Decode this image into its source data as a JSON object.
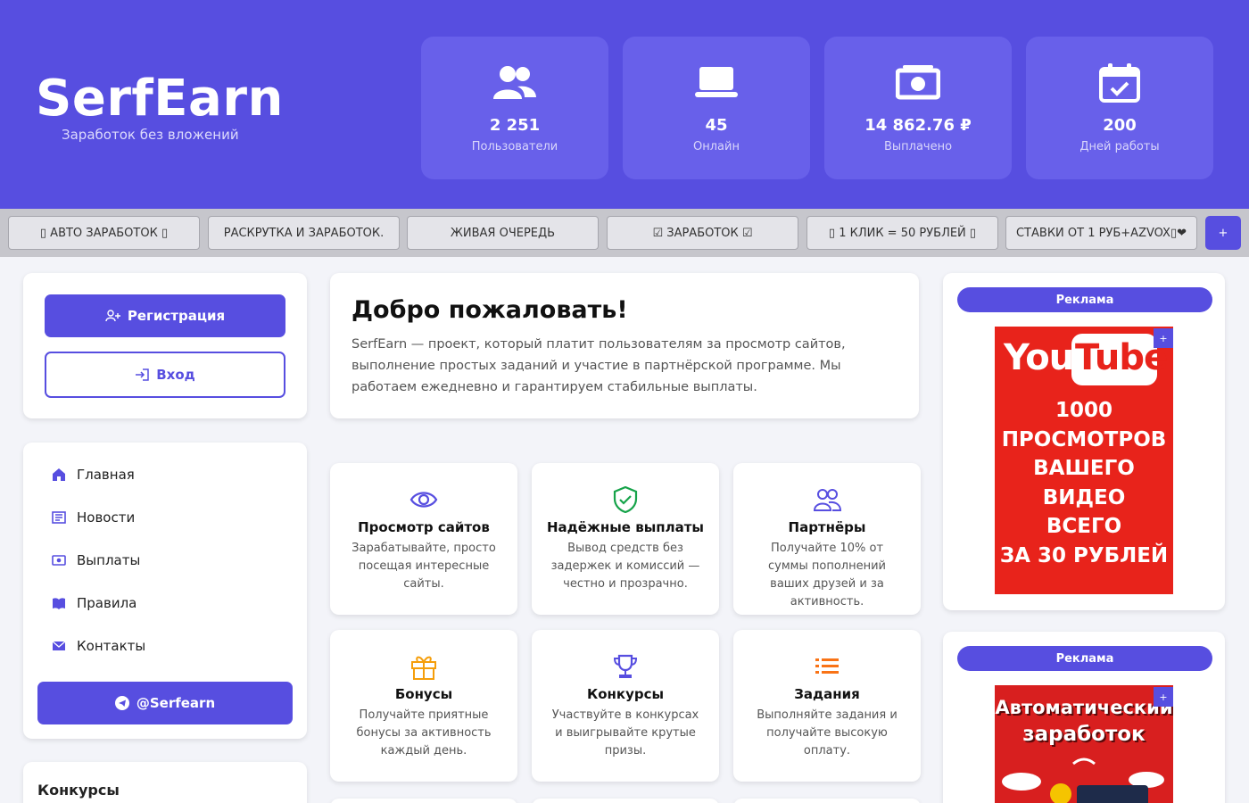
{
  "brand": {
    "name": "SerfEarn",
    "tagline": "Заработок без вложений"
  },
  "stats": [
    {
      "value": "2 251",
      "label": "Пользователи",
      "icon": "users-icon"
    },
    {
      "value": "45",
      "label": "Онлайн",
      "icon": "laptop-icon"
    },
    {
      "value": "14 862.76 ₽",
      "label": "Выплачено",
      "icon": "money-bill-icon"
    },
    {
      "value": "200",
      "label": "Дней работы",
      "icon": "calendar-check-icon"
    }
  ],
  "ticker": {
    "items": [
      "▯ АВТО ЗАРАБОТОК ▯",
      "РАСКРУТКА И ЗАРАБОТОК.",
      "ЖИВАЯ ОЧЕРЕДЬ",
      "☑ ЗАРАБОТОК ☑",
      "▯ 1 КЛИК = 50 РУБЛЕЙ ▯",
      "СТАВКИ ОТ 1 РУБ+AZVOX▯❤"
    ],
    "plus": "+"
  },
  "auth": {
    "register": "Регистрация",
    "login": "Вход"
  },
  "menu": {
    "items": [
      {
        "label": "Главная",
        "icon": "home-icon"
      },
      {
        "label": "Новости",
        "icon": "newspaper-icon"
      },
      {
        "label": "Выплаты",
        "icon": "money-icon"
      },
      {
        "label": "Правила",
        "icon": "book-icon"
      },
      {
        "label": "Контакты",
        "icon": "envelope-icon"
      }
    ],
    "telegram": "@Serfearn"
  },
  "contests": {
    "title": "Конкурсы"
  },
  "welcome": {
    "title": "Добро пожаловать!",
    "text": "SerfEarn — проект, который платит пользователям за просмотр сайтов, выполнение простых заданий и участие в партнёрской программе. Мы работаем ежедневно и гарантируем стабильные выплаты."
  },
  "features": [
    {
      "title": "Просмотр сайтов",
      "desc": "Зарабатывайте, просто посещая интересные сайты.",
      "icon": "eye-icon"
    },
    {
      "title": "Надёжные выплаты",
      "desc": "Вывод средств без задержек и комиссий — честно и прозрачно.",
      "icon": "shield-check-icon"
    },
    {
      "title": "Партнёры",
      "desc": "Получайте 10% от суммы пополнений ваших друзей и за активность.",
      "icon": "partners-icon"
    },
    {
      "title": "Бонусы",
      "desc": "Получайте приятные бонусы за активность каждый день.",
      "icon": "gift-icon"
    },
    {
      "title": "Конкурсы",
      "desc": "Участвуйте в конкурсах и выигрывайте крутые призы.",
      "icon": "trophy-icon"
    },
    {
      "title": "Задания",
      "desc": "Выполняйте задания и получайте высокую оплату.",
      "icon": "list-icon"
    }
  ],
  "ads": [
    {
      "label": "Реклама",
      "logo_a": "You",
      "logo_b": "Tube",
      "lines": [
        "1000",
        "ПРОСМОТРОВ",
        "ВАШЕГО",
        "ВИДЕО",
        "ВСЕГО",
        "ЗА 30 РУБЛЕЙ"
      ],
      "plus": "+"
    },
    {
      "label": "Реклама",
      "lines": [
        "Автоматический",
        "заработок"
      ],
      "plus": "+"
    }
  ],
  "colors": {
    "accent": "#574ee0",
    "orange": "#f59e0b",
    "green": "#16a34a",
    "ad_red": "#e8231b"
  }
}
